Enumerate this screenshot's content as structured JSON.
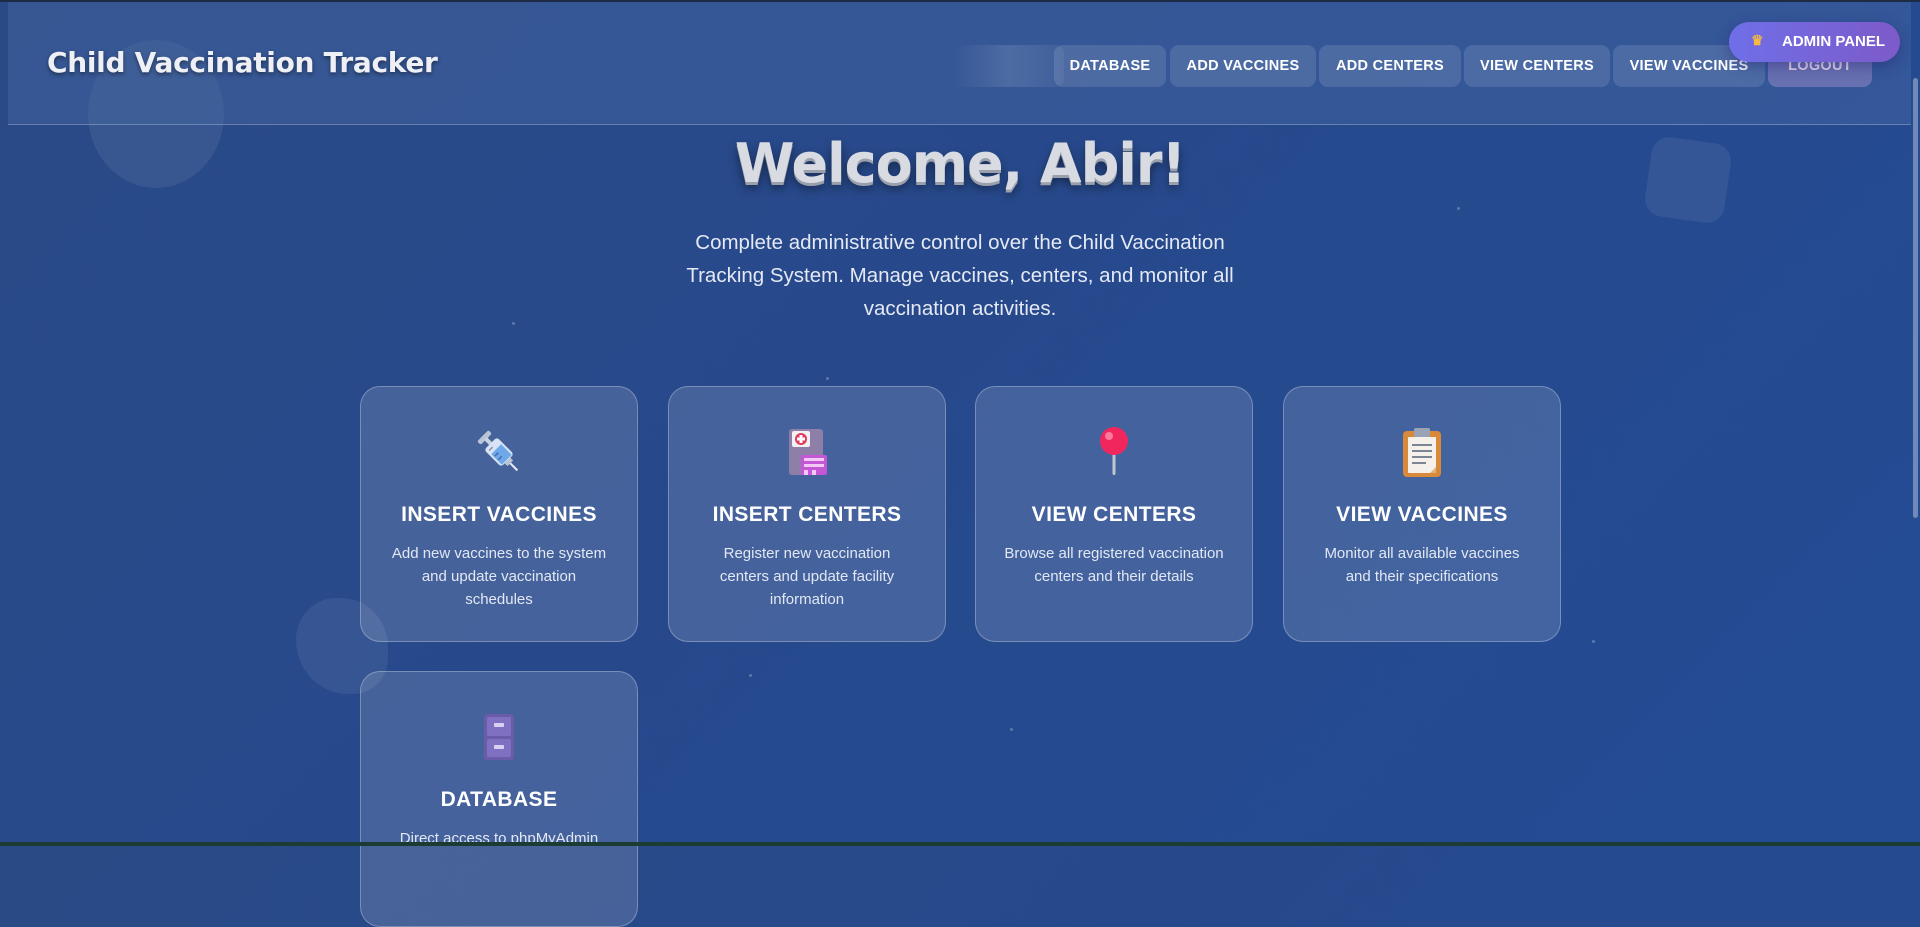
{
  "app": {
    "title": "Child Vaccination Tracker"
  },
  "nav": {
    "items": [
      "DATABASE",
      "ADD VACCINES",
      "ADD CENTERS",
      "VIEW CENTERS",
      "VIEW VACCINES",
      "LOGOUT"
    ]
  },
  "badge": {
    "label": "ADMIN PANEL",
    "icon": "crown-icon"
  },
  "hero": {
    "welcome": "Welcome, Abir!",
    "subtitle": "Complete administrative control over the Child Vaccination Tracking System. Manage vaccines, centers, and monitor all vaccination activities."
  },
  "cards": [
    {
      "icon": "syringe-icon",
      "title": "INSERT VACCINES",
      "description": "Add new vaccines to the system and update vaccination schedules"
    },
    {
      "icon": "hospital-icon",
      "title": "INSERT CENTERS",
      "description": "Register new vaccination centers and update facility information"
    },
    {
      "icon": "pushpin-icon",
      "title": "VIEW CENTERS",
      "description": "Browse all registered vaccination centers and their details"
    },
    {
      "icon": "clipboard-icon",
      "title": "VIEW VACCINES",
      "description": "Monitor all available vaccines and their specifications"
    },
    {
      "icon": "file-cabinet-icon",
      "title": "DATABASE",
      "description": "Direct access to phpMyAdmin"
    }
  ],
  "colors": {
    "background": "#27498c",
    "badge_start": "#6f6fe8",
    "badge_end": "#7d5ac9",
    "logout_tint": "#c8a0dc"
  }
}
